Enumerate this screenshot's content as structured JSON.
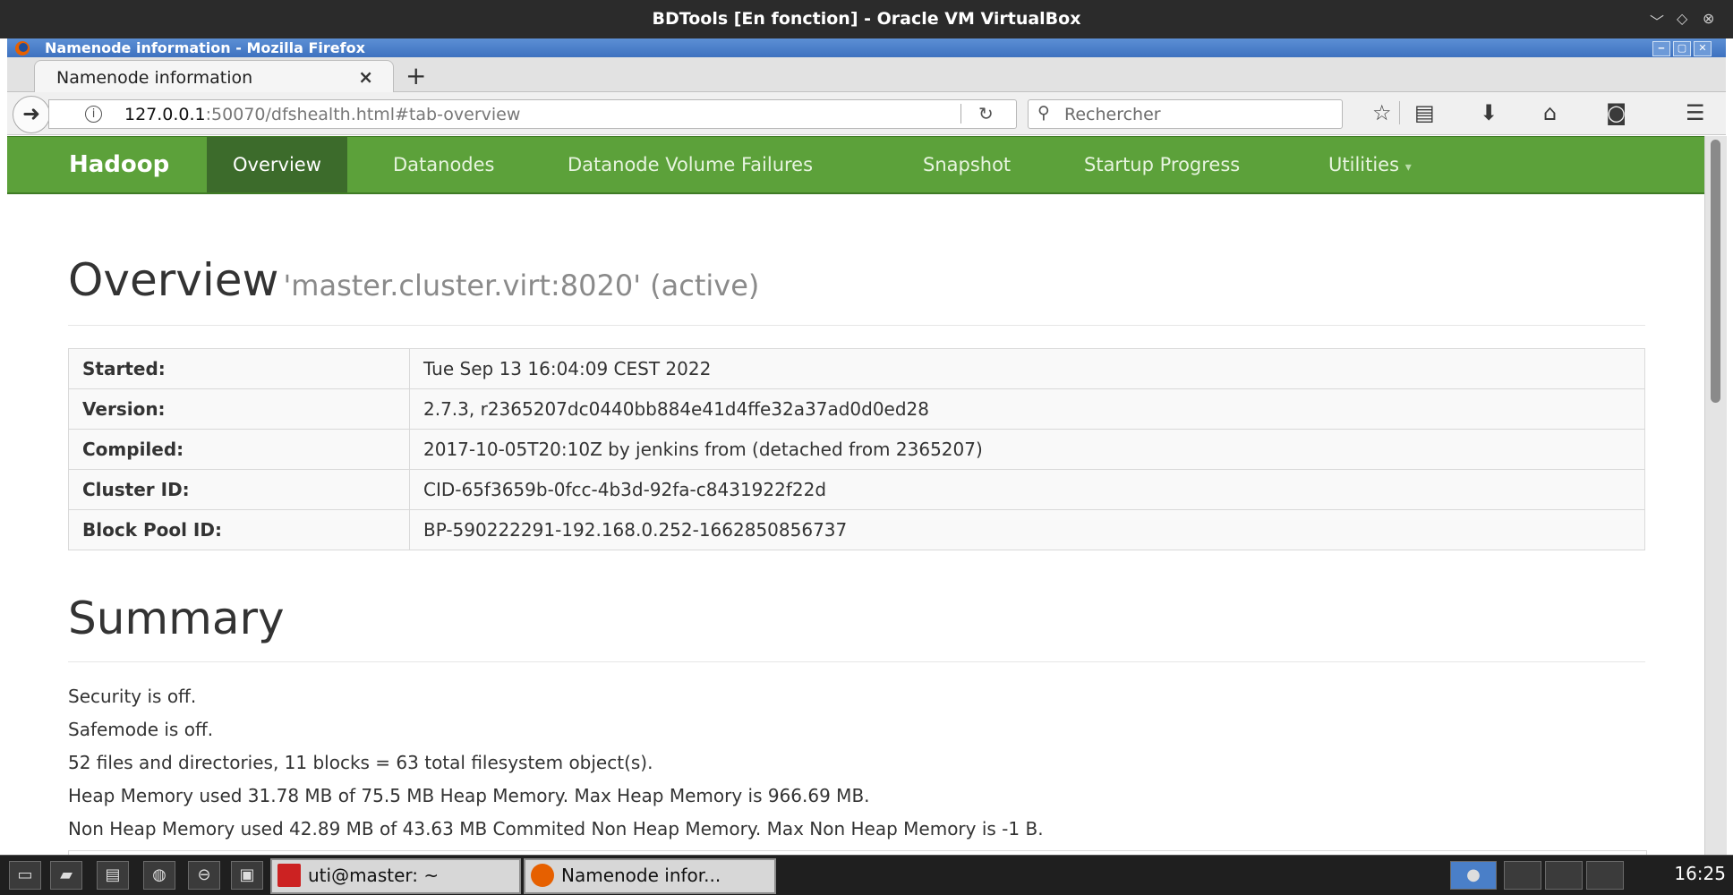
{
  "vbox": {
    "title": "BDTools [En fonction] - Oracle VM VirtualBox",
    "controls": [
      "﹀",
      "◇",
      "⊗"
    ]
  },
  "firefox": {
    "window_title": "Namenode information - Mozilla Firefox",
    "window_buttons": [
      "‒",
      "▢",
      "✕"
    ],
    "tab": {
      "label": "Namenode information",
      "close": "×"
    },
    "new_tab": "+",
    "url": {
      "host": "127.0.0.1",
      "rest": ":50070/dfshealth.html#tab-overview"
    },
    "search": {
      "placeholder": "Rechercher"
    },
    "toolbar_icons": [
      "star-icon",
      "reading-list-icon",
      "download-icon",
      "home-icon",
      "pocket-icon",
      "menu-icon"
    ]
  },
  "hadoop": {
    "brand": "Hadoop",
    "nav": [
      "Overview",
      "Datanodes",
      "Datanode Volume Failures",
      "Snapshot",
      "Startup Progress",
      "Utilities"
    ],
    "active_nav": "Overview",
    "utilities_caret": "▾"
  },
  "overview": {
    "title": "Overview",
    "subtitle": "'master.cluster.virt:8020' (active)",
    "rows": [
      {
        "key": "Started:",
        "value": "Tue Sep 13 16:04:09 CEST 2022"
      },
      {
        "key": "Version:",
        "value": "2.7.3, r2365207dc0440bb884e41d4ffe32a37ad0d0ed28"
      },
      {
        "key": "Compiled:",
        "value": "2017-10-05T20:10Z by jenkins from (detached from 2365207)"
      },
      {
        "key": "Cluster ID:",
        "value": "CID-65f3659b-0fcc-4b3d-92fa-c8431922f22d"
      },
      {
        "key": "Block Pool ID:",
        "value": "BP-590222291-192.168.0.252-1662850856737"
      }
    ]
  },
  "summary": {
    "title": "Summary",
    "lines": [
      "Security is off.",
      "Safemode is off.",
      "52 files and directories, 11 blocks = 63 total filesystem object(s).",
      "Heap Memory used 31.78 MB of 75.5 MB Heap Memory. Max Heap Memory is 966.69 MB.",
      "Non Heap Memory used 42.89 MB of 43.63 MB Commited Non Heap Memory. Max Non Heap Memory is -1 B."
    ]
  },
  "taskbar": {
    "terminal_task": "uti@master: ~",
    "firefox_task": "Namenode infor...",
    "clock": "16:25"
  },
  "colors": {
    "hadoop_green": "#5ca13a",
    "active_nav": "#3c6b2b",
    "firefox_titlebar": "#4a7fc8"
  }
}
